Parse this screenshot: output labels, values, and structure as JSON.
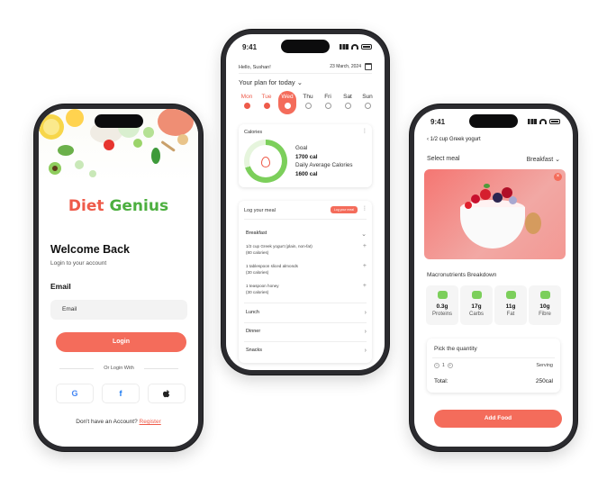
{
  "status": {
    "time_center": "9:41",
    "time_right": "9:41"
  },
  "login": {
    "logo_part1": "Diet",
    "logo_part2": "Genius",
    "title": "Welcome Back",
    "subtitle": "Login to your account",
    "email_label": "Email",
    "email_placeholder": "Email",
    "login_button": "Login",
    "or_login_with": "Or Login With",
    "footer_text": "Don't have an Account?",
    "register_link": "Register",
    "social": [
      "google-icon",
      "facebook-icon",
      "apple-icon"
    ],
    "colors": {
      "accent": "#f46c5b",
      "green": "#4caf3f"
    }
  },
  "plan": {
    "greeting": "Hello, Sushan!",
    "date": "23 March, 2024",
    "heading": "Your plan for today",
    "days": [
      {
        "label": "Mon",
        "state": "done"
      },
      {
        "label": "Tue",
        "state": "done"
      },
      {
        "label": "Wed",
        "state": "active"
      },
      {
        "label": "Thu",
        "state": "empty"
      },
      {
        "label": "Fri",
        "state": "empty"
      },
      {
        "label": "Sat",
        "state": "empty"
      },
      {
        "label": "Sun",
        "state": "empty"
      }
    ],
    "calories": {
      "title": "Calories",
      "goal_label": "Goal",
      "goal_value": "1700 cal",
      "avg_label": "Daily Average Calories",
      "avg_value": "1600 cal",
      "progress": 0.7
    },
    "log": {
      "title": "Log your meal",
      "badge": "Log your meal",
      "breakfast": "Breakfast",
      "items": [
        {
          "name": "1/2 cup Greek yogurt (plain, non-fat)",
          "cal": "(80 calories)"
        },
        {
          "name": "1 tablespoon sliced almonds",
          "cal": "(30 calories)"
        },
        {
          "name": "1 teaspoon honey",
          "cal": "(30 calories)"
        }
      ],
      "lunch": "Lunch",
      "dinner": "Dinner",
      "snacks": "Snacks"
    }
  },
  "food": {
    "back_title": "1/2 cup Greek yogurt",
    "select_meal_label": "Select meal",
    "select_meal_value": "Breakfast",
    "macro_title": "Macronutrients Breakdown",
    "macros": [
      {
        "value": "0.3g",
        "label": "Proteins"
      },
      {
        "value": "17g",
        "label": "Carbs"
      },
      {
        "value": "11g",
        "label": "Fat"
      },
      {
        "value": "10g",
        "label": "Fibre"
      }
    ],
    "quantity_title": "Pick the quantity",
    "quantity_value": "1",
    "serving_label": "Serving",
    "total_label": "Total:",
    "total_value": "250cal",
    "add_button": "Add Food"
  }
}
